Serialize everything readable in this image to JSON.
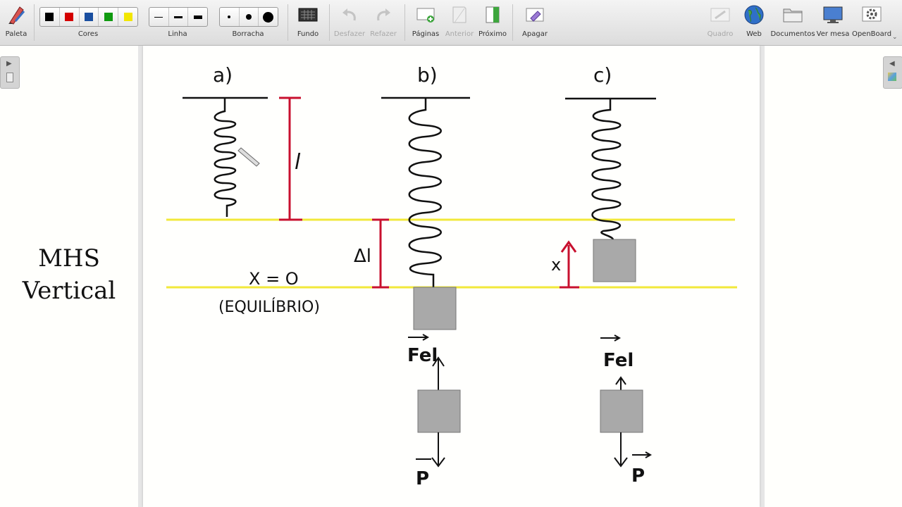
{
  "toolbar": {
    "left_tools": [
      {
        "label": "Paleta",
        "icon": "palette-pen-icon"
      }
    ],
    "colors": {
      "label": "Cores",
      "swatches": [
        "#000000",
        "#d40000",
        "#1a4fa0",
        "#109a10",
        "#f2e600"
      ]
    },
    "line": {
      "label": "Linha"
    },
    "eraser": {
      "label": "Borracha"
    },
    "actions": [
      {
        "label": "Fundo",
        "icon": "background-icon"
      },
      {
        "label": "Desfazer",
        "icon": "undo-icon"
      },
      {
        "label": "Refazer",
        "icon": "redo-icon"
      },
      {
        "label": "Páginas",
        "icon": "add-page-icon"
      },
      {
        "label": "Anterior",
        "icon": "previous-page-icon"
      },
      {
        "label": "Próximo",
        "icon": "next-page-icon"
      },
      {
        "label": "Apagar",
        "icon": "erase-page-icon"
      }
    ],
    "right_tools": [
      {
        "label": "Quadro",
        "icon": "board-icon"
      },
      {
        "label": "Web",
        "icon": "globe-icon"
      },
      {
        "label": "Documentos",
        "icon": "folder-icon"
      },
      {
        "label": "Ver mesa",
        "icon": "desktop-icon"
      },
      {
        "label": "OpenBoard",
        "icon": "gear-icon"
      }
    ]
  },
  "board": {
    "title_line1": "MHS",
    "title_line2": "Vertical",
    "case_a": "a)",
    "case_b": "b)",
    "case_c": "c)",
    "length_label": "l",
    "delta_label": "Δl",
    "x_label": "x",
    "equilibrium_value": "X = O",
    "equilibrium_label": "(EQUILÍBRIO)",
    "elastic_force": "Fel",
    "weight": "P"
  },
  "colors": {
    "line_yellow": "#f2e93a",
    "measure_red": "#c8102e",
    "mass_gray": "#a9a9a9"
  }
}
